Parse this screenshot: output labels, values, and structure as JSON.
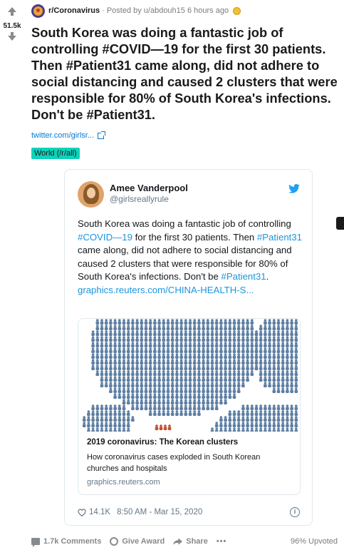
{
  "post": {
    "score": "51.5k",
    "subreddit": "r/Coronavirus",
    "posted_by": "Posted by u/abdouh15 6 hours ago",
    "title": "South Korea was doing a fantastic job of controlling #COVID—19 for the first 30 patients. Then #Patient31 came along, did not adhere to social distancing and caused 2 clusters that were responsible for 80% of South Korea's infections. Don't be #Patient31.",
    "link_text": "twitter.com/girlsr...",
    "flair": "World (/r/all)"
  },
  "tweet": {
    "author_name": "Amee Vanderpool",
    "author_handle": "@girlsreallyrule",
    "text_parts": {
      "p1": "South Korea was doing a fantastic job of controlling ",
      "tag1": "#COVID—19",
      "p2": " for the first 30 patients. Then ",
      "tag2": "#Patient31",
      "p3": " came along, did not adhere to social distancing and caused 2 clusters that were responsible for 80% of South Korea's infections. Don't be ",
      "tag3": "#Patient31",
      "p4": ".",
      "url": "graphics.reuters.com/CHINA-HEALTH-S..."
    },
    "card": {
      "title": "2019 coronavirus: The Korean clusters",
      "description": "How coronavirus cases exploded in South Korean churches and hospitals",
      "domain": "graphics.reuters.com"
    },
    "likes": "14.1K",
    "timestamp": "8:50 AM - Mar 15, 2020",
    "info_glyph": "i"
  },
  "actions": {
    "comments": "1.7k Comments",
    "give_award": "Give Award",
    "share": "Share",
    "more": "•••",
    "upvoted": "96% Upvoted"
  },
  "colors": {
    "link_blue": "#0079d3",
    "twitter_blue": "#1b95e0",
    "flair_bg": "#0dd3bb",
    "dot_blue": "#5d7ea3",
    "dot_red": "#c1502f"
  },
  "icons": [
    "upvote-icon",
    "downvote-icon",
    "subreddit-avatar",
    "award-icon",
    "external-link-icon",
    "twitter-bird-icon",
    "heart-icon",
    "info-icon",
    "comment-icon",
    "give-award-icon",
    "share-icon"
  ]
}
